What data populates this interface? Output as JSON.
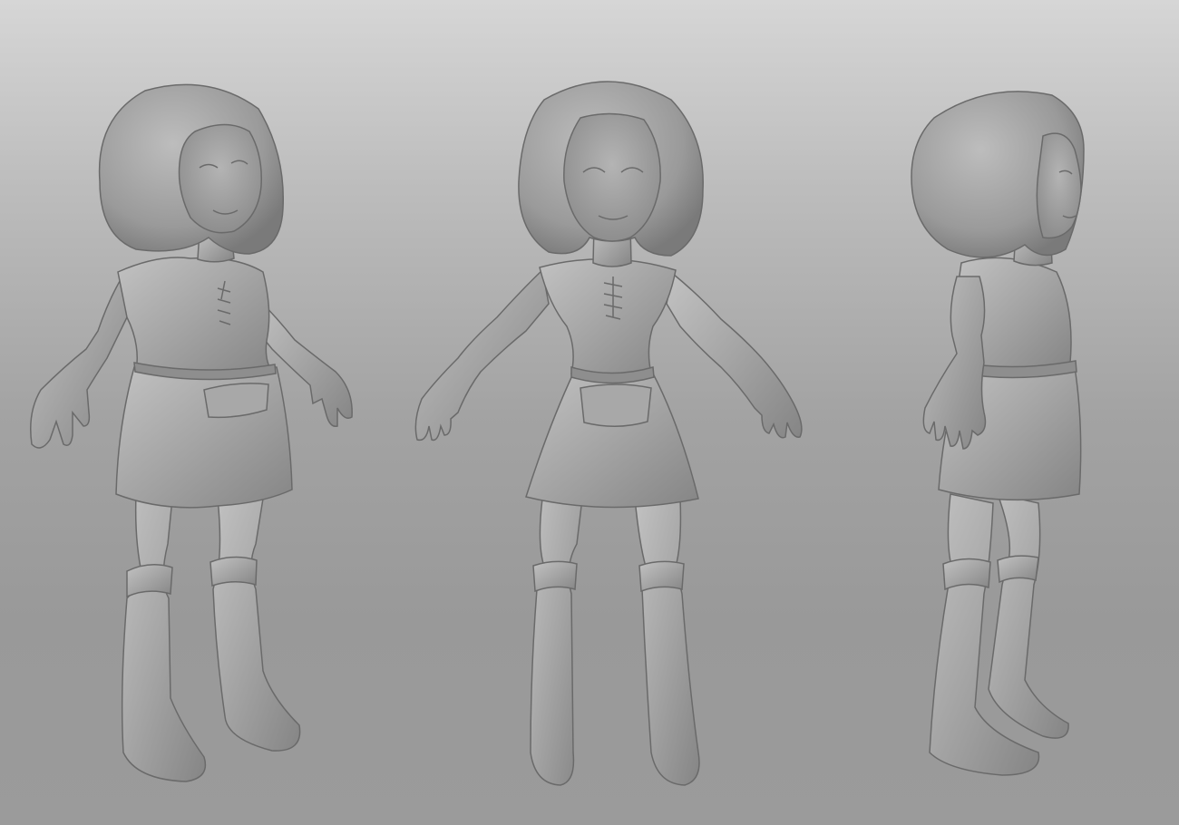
{
  "scene": {
    "subject": "character-turnaround",
    "material": "clay-gray",
    "colors": {
      "background_top": "#d6d6d6",
      "background_bottom": "#9b9b9b",
      "clay_light": "#b8b8b8",
      "clay_base": "#9e9e9e",
      "clay_dark": "#6e6e6e",
      "outline": "#5c5c5c"
    },
    "views": [
      {
        "name": "three-quarter-view"
      },
      {
        "name": "front-view"
      },
      {
        "name": "side-view"
      }
    ]
  }
}
